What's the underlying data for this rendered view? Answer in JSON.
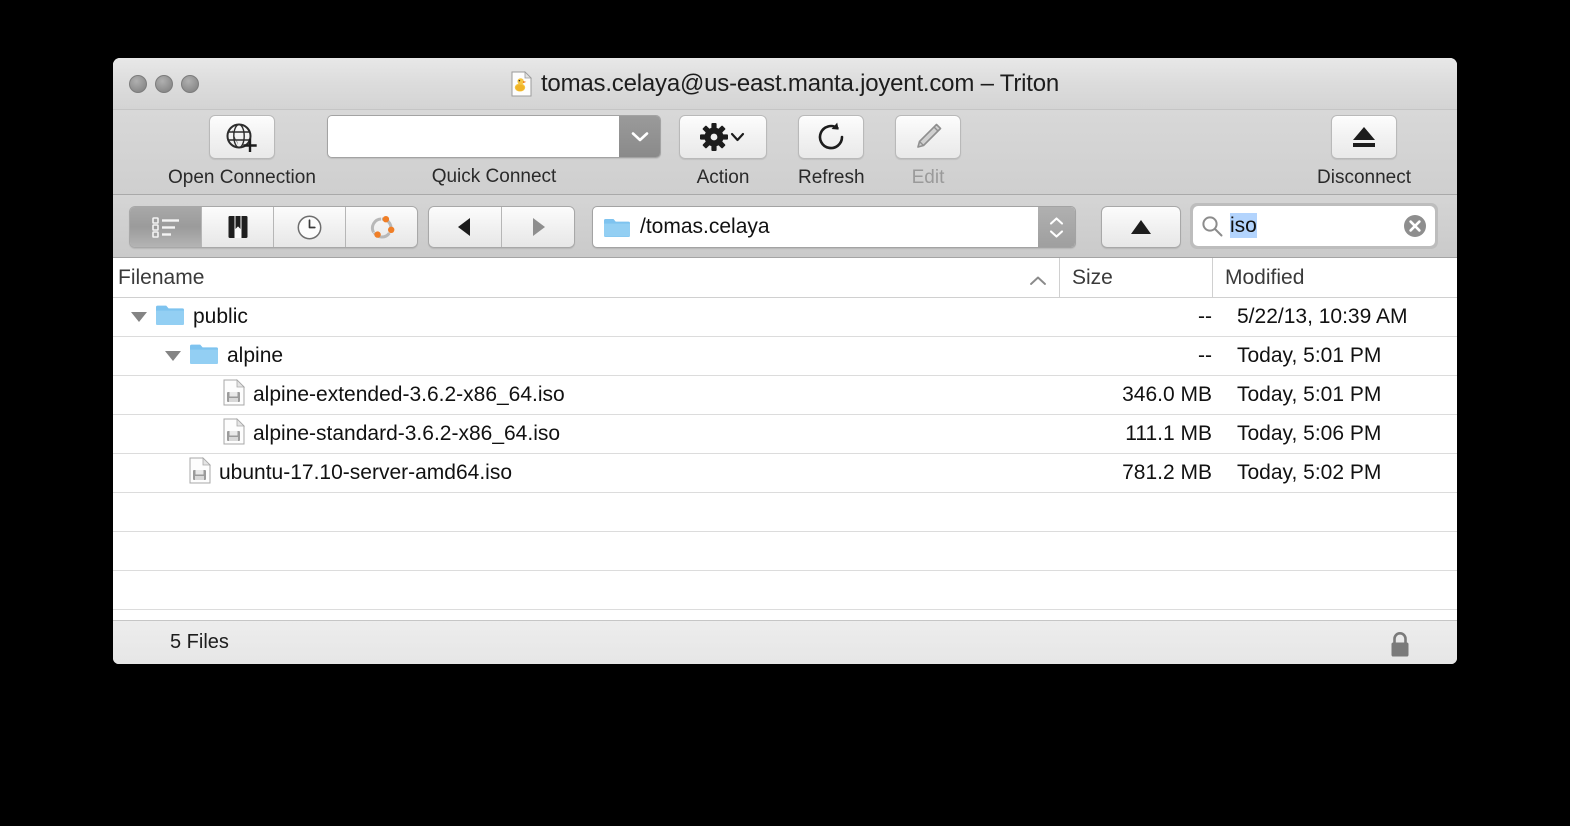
{
  "window": {
    "title": "tomas.celaya@us-east.manta.joyent.com – Triton",
    "app_icon": "cyberduck-document-icon"
  },
  "traffic_lights": [
    {
      "name": "close",
      "color": "#8c8c8c"
    },
    {
      "name": "minimize",
      "color": "#8c8c8c"
    },
    {
      "name": "zoom",
      "color": "#8c8c8c"
    }
  ],
  "toolbar": {
    "open_connection": {
      "label": "Open Connection",
      "icon": "globe-plus-icon",
      "enabled": true
    },
    "quick_connect": {
      "label": "Quick Connect",
      "value": "",
      "placeholder": "",
      "icon": "chevron-down-icon"
    },
    "action": {
      "label": "Action",
      "icon": "gear-icon",
      "enabled": true
    },
    "refresh": {
      "label": "Refresh",
      "icon": "refresh-icon",
      "enabled": true
    },
    "edit": {
      "label": "Edit",
      "icon": "pencil-icon",
      "enabled": false
    },
    "disconnect": {
      "label": "Disconnect",
      "icon": "eject-icon",
      "enabled": true
    }
  },
  "navbar": {
    "view_segments": [
      {
        "name": "browser",
        "icon": "list-view-icon",
        "selected": true
      },
      {
        "name": "bookmarks",
        "icon": "bookmark-book-icon",
        "selected": false
      },
      {
        "name": "history",
        "icon": "clock-icon",
        "selected": false
      },
      {
        "name": "connections",
        "icon": "network-nodes-icon",
        "selected": false
      }
    ],
    "back": {
      "icon": "back-arrow-icon",
      "enabled": true
    },
    "forward": {
      "icon": "forward-arrow-icon",
      "enabled": false
    },
    "path": {
      "value": "/tomas.celaya",
      "icon": "folder-icon"
    },
    "up": {
      "icon": "up-triangle-icon",
      "enabled": true
    },
    "search": {
      "value": "iso",
      "selected": true,
      "icon": "search-icon",
      "clear_icon": "clear-circle-icon"
    }
  },
  "file_list": {
    "columns": [
      {
        "key": "filename",
        "label": "Filename",
        "sort": "ascending",
        "sort_icon": "chevron-up-icon"
      },
      {
        "key": "size",
        "label": "Size"
      },
      {
        "key": "modified",
        "label": "Modified"
      }
    ],
    "rows": [
      {
        "name": "public",
        "type": "folder",
        "icon": "folder-icon",
        "depth": 0,
        "expanded": true,
        "disclosure_icon": "disclosure-triangle-down-icon",
        "size": "--",
        "modified": "5/22/13, 10:39 AM"
      },
      {
        "name": "alpine",
        "type": "folder",
        "icon": "folder-icon",
        "depth": 1,
        "expanded": true,
        "disclosure_icon": "disclosure-triangle-down-icon",
        "size": "--",
        "modified": "Today, 5:01 PM"
      },
      {
        "name": "alpine-extended-3.6.2-x86_64.iso",
        "type": "file",
        "icon": "disk-image-file-icon",
        "depth": 2,
        "expanded": false,
        "size": "346.0 MB",
        "modified": "Today, 5:01 PM"
      },
      {
        "name": "alpine-standard-3.6.2-x86_64.iso",
        "type": "file",
        "icon": "disk-image-file-icon",
        "depth": 2,
        "expanded": false,
        "size": "111.1 MB",
        "modified": "Today, 5:06 PM"
      },
      {
        "name": "ubuntu-17.10-server-amd64.iso",
        "type": "file",
        "icon": "disk-image-file-icon",
        "depth": 1,
        "expanded": false,
        "size": "781.2 MB",
        "modified": "Today, 5:02 PM"
      }
    ],
    "empty_rows": 4
  },
  "statusbar": {
    "text": "5 Files",
    "lock_icon": "padlock-locked-icon"
  },
  "colors": {
    "folder_blue": "#8cc6ee",
    "selection_blue": "#b3d4fd",
    "window_chrome": "#d4d4d4",
    "row_divider": "#dcdcdc"
  }
}
